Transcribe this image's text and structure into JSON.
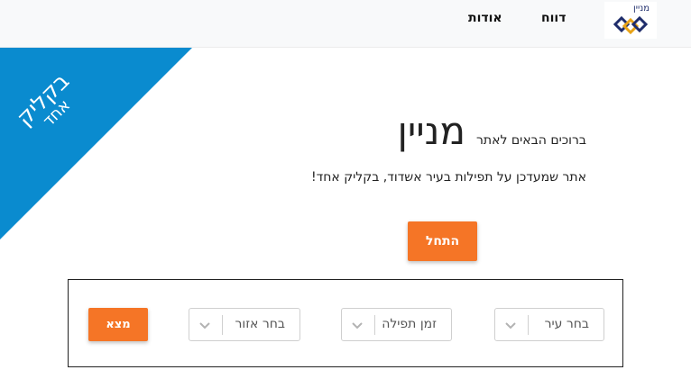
{
  "header": {
    "logo_text": "מניין",
    "nav": [
      {
        "label": "דווח"
      },
      {
        "label": "אודות"
      }
    ]
  },
  "corner_banner": {
    "line1": "בקליק",
    "line2": "אחד",
    "color": "#0a8bcf"
  },
  "hero": {
    "welcome": "ברוכים הבאים לאתר",
    "brand": "מניין",
    "tagline": "אתר שמעדכן על תפילות בעיר אשדוד, בקליק אחד!",
    "start_button": "התחל"
  },
  "search": {
    "city_select": "בחר עיר",
    "prayer_time_select": "זמן תפילה",
    "area_select": "בחר אזור",
    "find_button": "מצא"
  },
  "colors": {
    "accent": "#f57526",
    "banner": "#0a8bcf",
    "logo_blue": "#1f2d6b",
    "logo_gold": "#e8a317"
  },
  "icons": {
    "select_arrow": "chevron-down-icon",
    "logo": "diamond-logo-icon"
  }
}
